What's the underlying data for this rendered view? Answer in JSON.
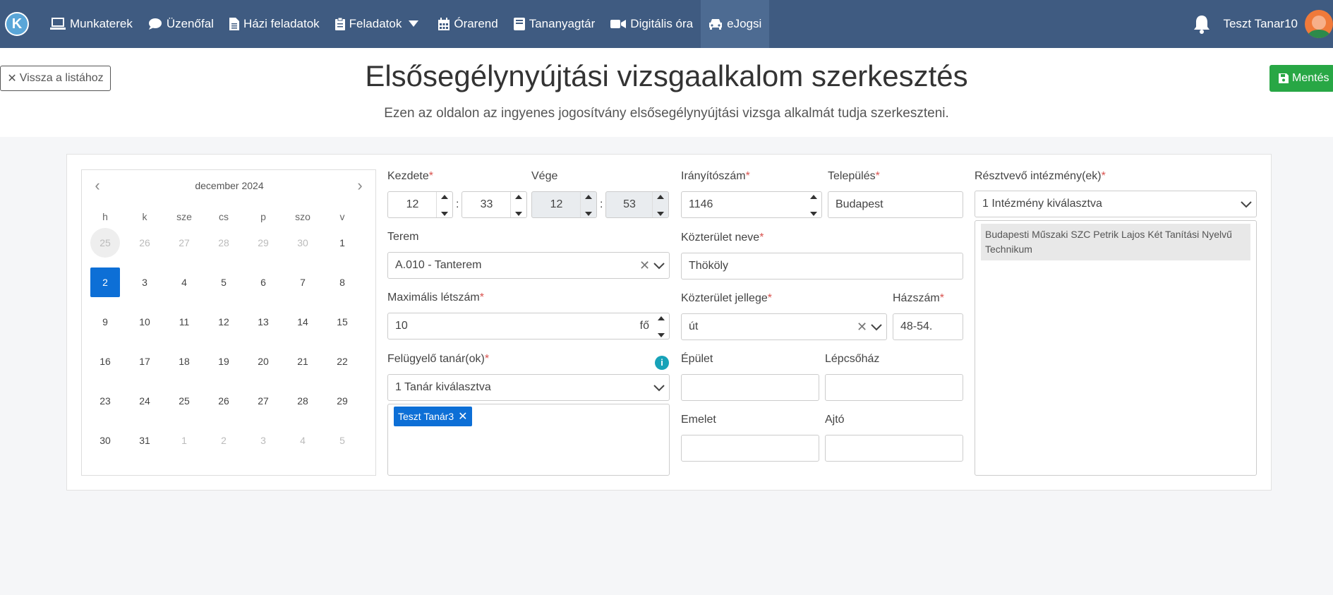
{
  "nav": {
    "logo": "K",
    "items": [
      {
        "label": "Munkaterek",
        "icon": "laptop-icon"
      },
      {
        "label": "Üzenőfal",
        "icon": "comment-icon"
      },
      {
        "label": "Házi feladatok",
        "icon": "file-icon"
      },
      {
        "label": "Feladatok",
        "icon": "clipboard-icon"
      },
      {
        "label": "Órarend",
        "icon": "calendar-icon"
      },
      {
        "label": "Tananyagtár",
        "icon": "book-icon"
      },
      {
        "label": "Digitális óra",
        "icon": "video-icon"
      },
      {
        "label": "eJogsi",
        "icon": "car-icon"
      }
    ],
    "user_name": "Teszt Tanar10"
  },
  "header": {
    "back_label": "Vissza a listához",
    "title": "Elsősegélynyújtási vizsgaalkalom szerkesztés",
    "subtitle": "Ezen az oldalon az ingyenes jogosítvány elsősegélynyújtási vizsga alkalmát tudja szerkeszteni.",
    "save_label": "Mentés"
  },
  "calendar": {
    "month": "december 2024",
    "weekdays": [
      "h",
      "k",
      "sze",
      "cs",
      "p",
      "szo",
      "v"
    ],
    "weeks": [
      [
        "25",
        "26",
        "27",
        "28",
        "29",
        "30",
        "1"
      ],
      [
        "2",
        "3",
        "4",
        "5",
        "6",
        "7",
        "8"
      ],
      [
        "9",
        "10",
        "11",
        "12",
        "13",
        "14",
        "15"
      ],
      [
        "16",
        "17",
        "18",
        "19",
        "20",
        "21",
        "22"
      ],
      [
        "23",
        "24",
        "25",
        "26",
        "27",
        "28",
        "29"
      ],
      [
        "30",
        "31",
        "1",
        "2",
        "3",
        "4",
        "5"
      ]
    ],
    "selected": "2"
  },
  "form": {
    "start_label": "Kezdete",
    "start_hour": "12",
    "start_minute": "33",
    "end_label": "Vége",
    "end_hour": "12",
    "end_minute": "53",
    "room_label": "Terem",
    "room_value": "A.010 - Tanterem",
    "max_label": "Maximális létszám",
    "max_value": "10",
    "max_unit": "fő",
    "supervisor_label": "Felügyelő tanár(ok)",
    "supervisor_summary": "1 Tanár kiválasztva",
    "supervisor_tag": "Teszt Tanár3",
    "zip_label": "Irányítószám",
    "zip_value": "1146",
    "city_label": "Település",
    "city_value": "Budapest",
    "street_label": "Közterület neve",
    "street_value": "Thököly",
    "street_type_label": "Közterület jellege",
    "street_type_value": "út",
    "house_label": "Házszám",
    "house_value": "48-54.",
    "building_label": "Épület",
    "stair_label": "Lépcsőház",
    "floor_label": "Emelet",
    "door_label": "Ajtó",
    "inst_label": "Résztvevő intézmény(ek)",
    "inst_summary": "1 Intézmény kiválasztva",
    "inst_item": "Budapesti Műszaki SZC Petrik Lajos Két Tanítási Nyelvű Technikum",
    "required_mark": "*"
  }
}
